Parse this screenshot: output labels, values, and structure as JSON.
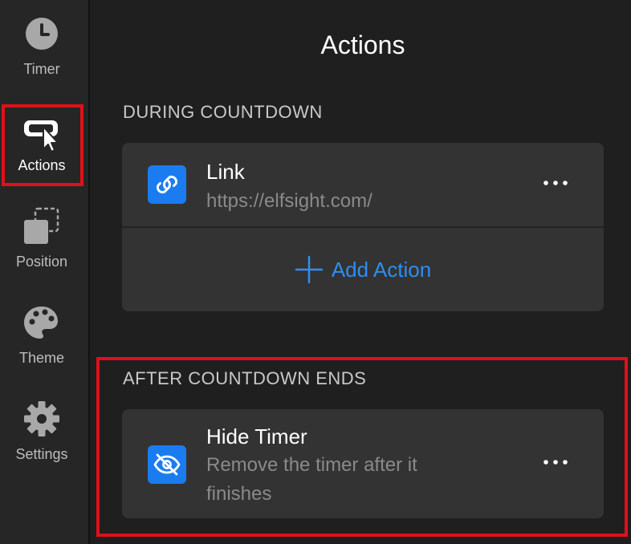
{
  "sidebar": {
    "items": [
      {
        "label": "Timer",
        "icon": "clock-icon"
      },
      {
        "label": "Actions",
        "icon": "cursor-click-icon"
      },
      {
        "label": "Position",
        "icon": "position-icon"
      },
      {
        "label": "Theme",
        "icon": "palette-icon"
      },
      {
        "label": "Settings",
        "icon": "gear-icon"
      }
    ],
    "active": "Actions"
  },
  "main": {
    "title": "Actions",
    "during_section": {
      "heading": "DURING COUNTDOWN",
      "actions": [
        {
          "title": "Link",
          "description": "https://elfsight.com/",
          "icon": "link-icon"
        }
      ],
      "add_label": "Add Action"
    },
    "after_section": {
      "heading": "AFTER COUNTDOWN ENDS",
      "actions": [
        {
          "title": "Hide Timer",
          "description": "Remove the timer after it finishes",
          "icon": "eye-off-icon"
        }
      ]
    }
  },
  "colors": {
    "accent": "#1a7cf0",
    "link": "#2e8ef5",
    "highlight": "#e0101a",
    "card": "#333333",
    "background": "#1f1f1f"
  }
}
